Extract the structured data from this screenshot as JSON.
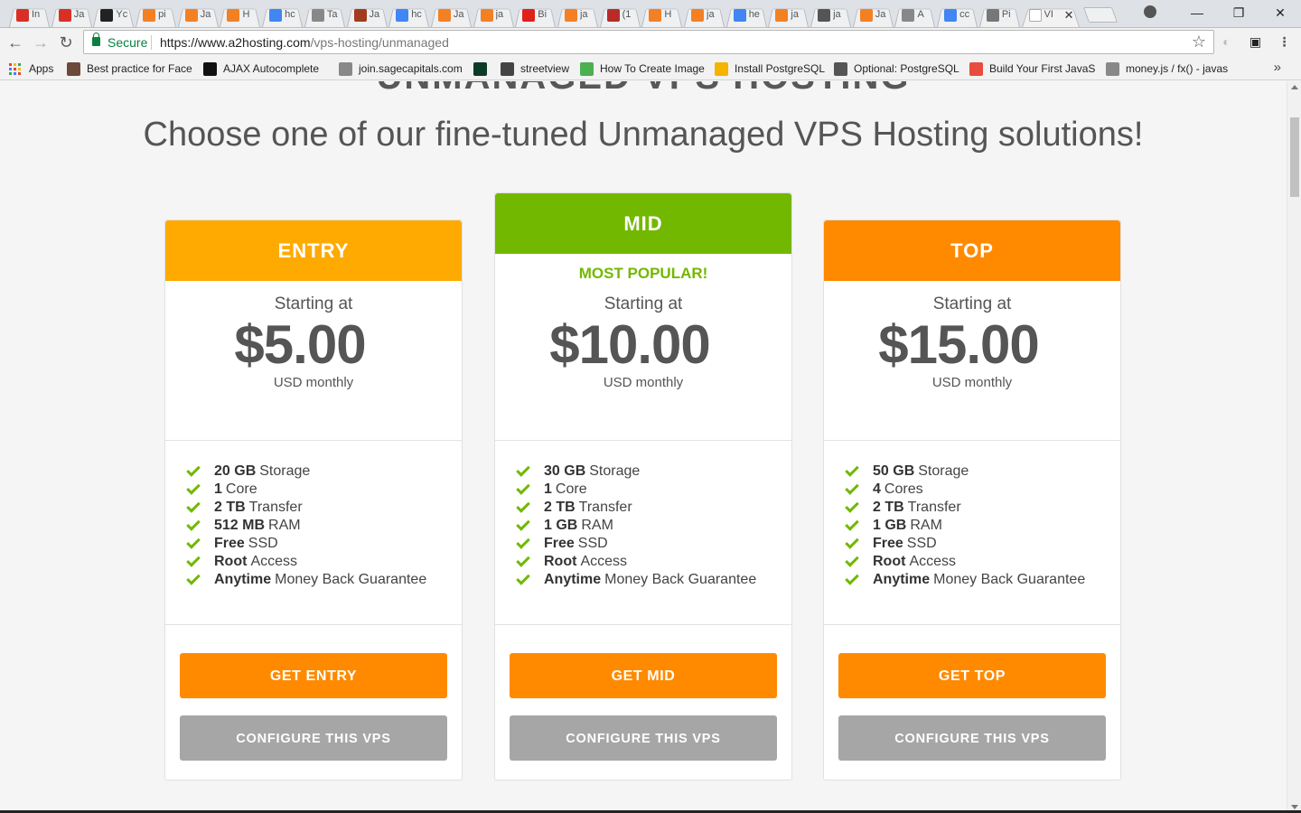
{
  "browser": {
    "tabs": [
      {
        "title": "In",
        "icon": "gmail-icon",
        "color": "#d93025"
      },
      {
        "title": "Ja",
        "icon": "gmail-icon",
        "color": "#d93025"
      },
      {
        "title": "Yc",
        "icon": "github-icon",
        "color": "#222222"
      },
      {
        "title": "pi",
        "icon": "stackoverflow-icon",
        "color": "#f48024"
      },
      {
        "title": "Ja",
        "icon": "stackoverflow-icon",
        "color": "#f48024"
      },
      {
        "title": "H",
        "icon": "stackoverflow-icon",
        "color": "#f48024"
      },
      {
        "title": "hc",
        "icon": "google-icon",
        "color": "#4285f4"
      },
      {
        "title": "Ta",
        "icon": "page-icon",
        "color": "#888888"
      },
      {
        "title": "Ja",
        "icon": "shield-icon",
        "color": "#a33b1f"
      },
      {
        "title": "hc",
        "icon": "google-icon",
        "color": "#4285f4"
      },
      {
        "title": "Ja",
        "icon": "stackoverflow-icon",
        "color": "#f48024"
      },
      {
        "title": "ja",
        "icon": "stackoverflow-icon",
        "color": "#f48024"
      },
      {
        "title": "Bi",
        "icon": "oracle-icon",
        "color": "#e0201b"
      },
      {
        "title": "ja",
        "icon": "stackoverflow-icon",
        "color": "#f48024"
      },
      {
        "title": "(1",
        "icon": "quora-icon",
        "color": "#b92b27"
      },
      {
        "title": "H",
        "icon": "stackoverflow-icon",
        "color": "#f48024"
      },
      {
        "title": "ja",
        "icon": "stackoverflow-icon",
        "color": "#f48024"
      },
      {
        "title": "he",
        "icon": "google-icon",
        "color": "#4285f4"
      },
      {
        "title": "ja",
        "icon": "stackoverflow-icon",
        "color": "#f48024"
      },
      {
        "title": "ja",
        "icon": "globe-icon",
        "color": "#555555"
      },
      {
        "title": "Ja",
        "icon": "stackoverflow-icon",
        "color": "#f48024"
      },
      {
        "title": "A",
        "icon": "page-icon",
        "color": "#888888"
      },
      {
        "title": "cc",
        "icon": "google-icon",
        "color": "#4285f4"
      },
      {
        "title": "Pi",
        "icon": "loading-icon",
        "color": "#777777"
      }
    ],
    "active_tab": {
      "title": "VI",
      "close": "✕"
    },
    "window_controls": {
      "minimize": "—",
      "maximize": "❐",
      "close": "✕"
    },
    "nav": {
      "back": "←",
      "forward": "→",
      "reload": "↻"
    },
    "address": {
      "secure_label": "Secure",
      "url_host": "https://www.a2hosting.com",
      "url_path": "/vps-hosting/unmanaged"
    },
    "bookmarks": [
      {
        "label": "Apps",
        "icon": "apps-grid-icon"
      },
      {
        "label": "Best practice for Face",
        "icon": "avatar-icon",
        "color": "#6b4a3a"
      },
      {
        "label": "AJAX Autocomplete",
        "icon": "r-logo-icon",
        "color": "#111111"
      },
      {
        "label": "join.sagecapitals.com",
        "icon": "page-icon",
        "color": "#888888"
      },
      {
        "label": "",
        "icon": "django-icon",
        "color": "#0c3c26"
      },
      {
        "label": "streetview",
        "icon": "code-icon",
        "color": "#444444"
      },
      {
        "label": "How To Create Image",
        "icon": "w3-icon",
        "color": "#4caf50"
      },
      {
        "label": "Install PostgreSQL",
        "icon": "chrome-icon",
        "color": "#f4b400"
      },
      {
        "label": "Optional: PostgreSQL",
        "icon": "book-icon",
        "color": "#555555"
      },
      {
        "label": "Build Your First JavaS",
        "icon": "plus-icon",
        "color": "#e74c3c"
      },
      {
        "label": "money.js / fx() - javas",
        "icon": "page-icon",
        "color": "#888888"
      }
    ],
    "bookmarks_more": "»"
  },
  "page": {
    "cut_heading": "UNMANAGED VPS HOSTING",
    "subheading": "Choose one of our fine-tuned Unmanaged VPS Hosting solutions!",
    "plans": [
      {
        "name": "ENTRY",
        "color": "#ffaa00",
        "badge": "",
        "starting": "Starting at",
        "price": "$5.00",
        "period": "USD monthly",
        "features": [
          {
            "bold": "20 GB",
            "text": "Storage"
          },
          {
            "bold": "1",
            "text": "Core"
          },
          {
            "bold": "2 TB",
            "text": "Transfer"
          },
          {
            "bold": "512 MB",
            "text": "RAM"
          },
          {
            "bold": "Free",
            "text": "SSD"
          },
          {
            "bold": "Root",
            "text": "Access"
          },
          {
            "bold": "Anytime",
            "text": "Money Back Guarantee"
          }
        ],
        "buy_label": "GET ENTRY",
        "config_label": "CONFIGURE THIS VPS"
      },
      {
        "name": "MID",
        "color": "#72b800",
        "badge": "MOST POPULAR!",
        "starting": "Starting at",
        "price": "$10.00",
        "period": "USD monthly",
        "features": [
          {
            "bold": "30 GB",
            "text": "Storage"
          },
          {
            "bold": "1",
            "text": "Core"
          },
          {
            "bold": "2 TB",
            "text": "Transfer"
          },
          {
            "bold": "1 GB",
            "text": "RAM"
          },
          {
            "bold": "Free",
            "text": "SSD"
          },
          {
            "bold": "Root",
            "text": "Access"
          },
          {
            "bold": "Anytime",
            "text": "Money Back Guarantee"
          }
        ],
        "buy_label": "GET MID",
        "config_label": "CONFIGURE THIS VPS"
      },
      {
        "name": "TOP",
        "color": "#ff8a00",
        "badge": "",
        "starting": "Starting at",
        "price": "$15.00",
        "period": "USD monthly",
        "features": [
          {
            "bold": "50 GB",
            "text": "Storage"
          },
          {
            "bold": "4",
            "text": "Cores"
          },
          {
            "bold": "2 TB",
            "text": "Transfer"
          },
          {
            "bold": "1 GB",
            "text": "RAM"
          },
          {
            "bold": "Free",
            "text": "SSD"
          },
          {
            "bold": "Root",
            "text": "Access"
          },
          {
            "bold": "Anytime",
            "text": "Money Back Guarantee"
          }
        ],
        "buy_label": "GET TOP",
        "config_label": "CONFIGURE THIS VPS"
      }
    ]
  },
  "colors": {
    "accent_orange": "#ff8a00",
    "accent_green": "#72b800",
    "button_gray": "#a6a6a6",
    "secure_green": "#0b8043"
  }
}
